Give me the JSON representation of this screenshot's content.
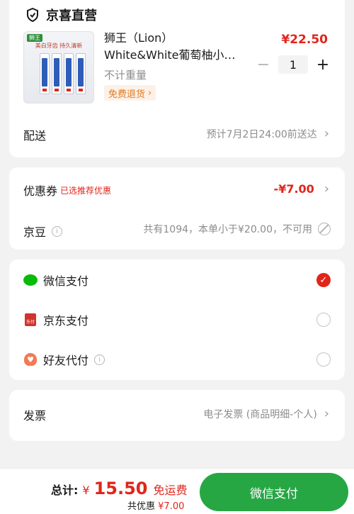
{
  "store": {
    "name": "京喜直营",
    "product": {
      "title_line1": "狮王（Lion）",
      "title_line2": "White&White葡萄柚小…",
      "spec": "不计重量",
      "return_badge": "免费退货",
      "price": "¥22.50",
      "quantity": "1",
      "image_brand": "狮王",
      "image_slogan": "美白牙齿 持久清新"
    },
    "shipping": {
      "label": "配送",
      "value": "预计7月2日24:00前送达"
    }
  },
  "coupon": {
    "label": "优惠券",
    "hint": "已选推荐优惠",
    "amount": "-¥7.00"
  },
  "jingdou": {
    "label": "京豆",
    "info": "共有1094，本单小于¥20.00，不可用"
  },
  "payment": {
    "options": [
      {
        "label": "微信支付",
        "selected": true
      },
      {
        "label": "京东支付",
        "selected": false
      },
      {
        "label": "好友代付",
        "selected": false
      }
    ]
  },
  "invoice": {
    "label": "发票",
    "value": "电子发票 (商品明细-个人)"
  },
  "footer": {
    "total_label": "总计:",
    "currency": "¥",
    "total_amount": "15.50",
    "free_shipping": "免运费",
    "saved_label": "共优惠",
    "saved_amount": "¥7.00",
    "pay_button": "微信支付"
  },
  "colors": {
    "accent_red": "#e1251b",
    "pay_green": "#26a744",
    "background": "#f2f2f2"
  }
}
